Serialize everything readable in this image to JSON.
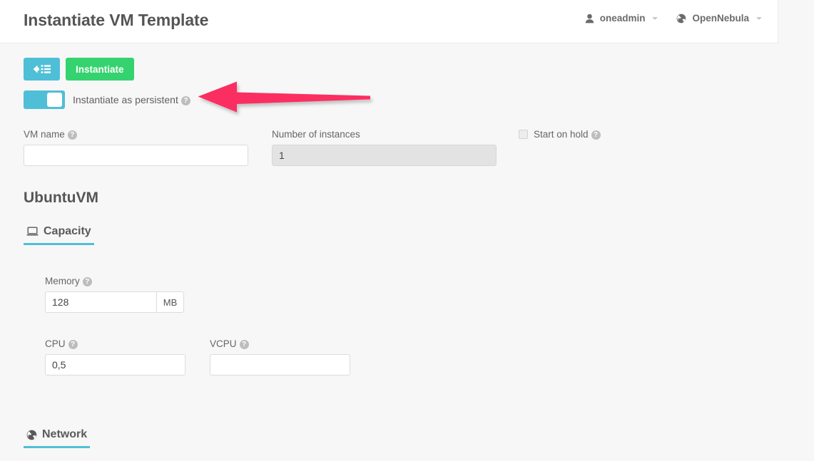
{
  "header": {
    "title": "Instantiate VM Template",
    "user_menu": {
      "icon": "user-icon",
      "label": "oneadmin"
    },
    "zone_menu": {
      "icon": "globe-icon",
      "label": "OpenNebula"
    }
  },
  "toolbar": {
    "back_button": {
      "icon": "back-to-list-icon",
      "label": ""
    },
    "instantiate_label": "Instantiate"
  },
  "persistent_toggle": {
    "label": "Instantiate as persistent",
    "state": "on",
    "help_icon": "question-mark-icon",
    "help_label": "?"
  },
  "form": {
    "vm_name": {
      "label": "VM name",
      "value": "",
      "placeholder": "",
      "help_label": "?"
    },
    "number_of_instances": {
      "label": "Number of instances",
      "value": "1",
      "placeholder": ""
    },
    "start_on_hold": {
      "label": "Start on hold",
      "checked": false,
      "help_label": "?"
    }
  },
  "template": {
    "name": "UbuntuVM"
  },
  "tabs": [
    {
      "id": "capacity",
      "label": "Capacity",
      "icon": "laptop-icon",
      "icon_glyph": "⌸",
      "active": true
    },
    {
      "id": "network",
      "label": "Network",
      "icon": "globe-icon",
      "icon_glyph": "●",
      "active": true
    }
  ],
  "capacity": {
    "memory": {
      "label": "Memory",
      "value": "128",
      "unit": "MB",
      "help_label": "?"
    },
    "cpu": {
      "label": "CPU",
      "value": "0,5",
      "help_label": "?"
    },
    "vcpu": {
      "label": "VCPU",
      "value": "",
      "placeholder": "",
      "help_label": "?"
    }
  },
  "annotation": {
    "type": "arrow",
    "direction": "left",
    "color": "#fb2e62",
    "points_to": "persistent-toggle"
  },
  "colors": {
    "accent_blue": "#4ebfd6",
    "success_green": "#34d36f",
    "annotation_pink": "#fb2e62",
    "page_background": "#f7f7f7",
    "panel_background": "#ffffff"
  }
}
